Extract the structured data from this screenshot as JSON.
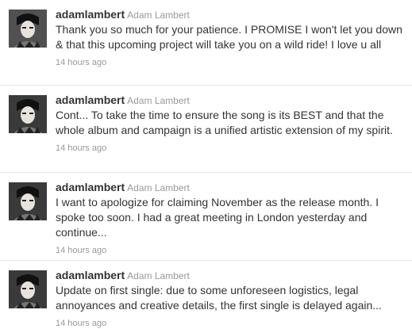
{
  "tweets": [
    {
      "screen_name": "adamlambert",
      "full_name": "Adam Lambert",
      "text": "Thank you so much for your patience. I PROMISE I won't let you down & that this upcoming project will take you on a wild ride! I love u all",
      "timestamp": "14 hours ago",
      "avatar_icon": "profile-photo"
    },
    {
      "screen_name": "adamlambert",
      "full_name": "Adam Lambert",
      "text": "Cont... To take the time to ensure the song is its BEST and that the whole album and campaign is a unified artistic extension of my spirit.",
      "timestamp": "14 hours ago",
      "avatar_icon": "profile-photo"
    },
    {
      "screen_name": "adamlambert",
      "full_name": "Adam Lambert",
      "text": "I want to apologize for claiming November as the release month. I spoke too soon. I had a great meeting in London yesterday and continue...",
      "timestamp": "14 hours ago",
      "avatar_icon": "profile-photo"
    },
    {
      "screen_name": "adamlambert",
      "full_name": "Adam Lambert",
      "text": "Update on first single: due to some unforeseen logistics, legal annoyances and creative details, the first single is delayed again...",
      "timestamp": "14 hours ago",
      "avatar_icon": "profile-photo"
    }
  ],
  "colors": {
    "text": "#333333",
    "muted": "#999999",
    "divider": "#e6e6e6"
  }
}
